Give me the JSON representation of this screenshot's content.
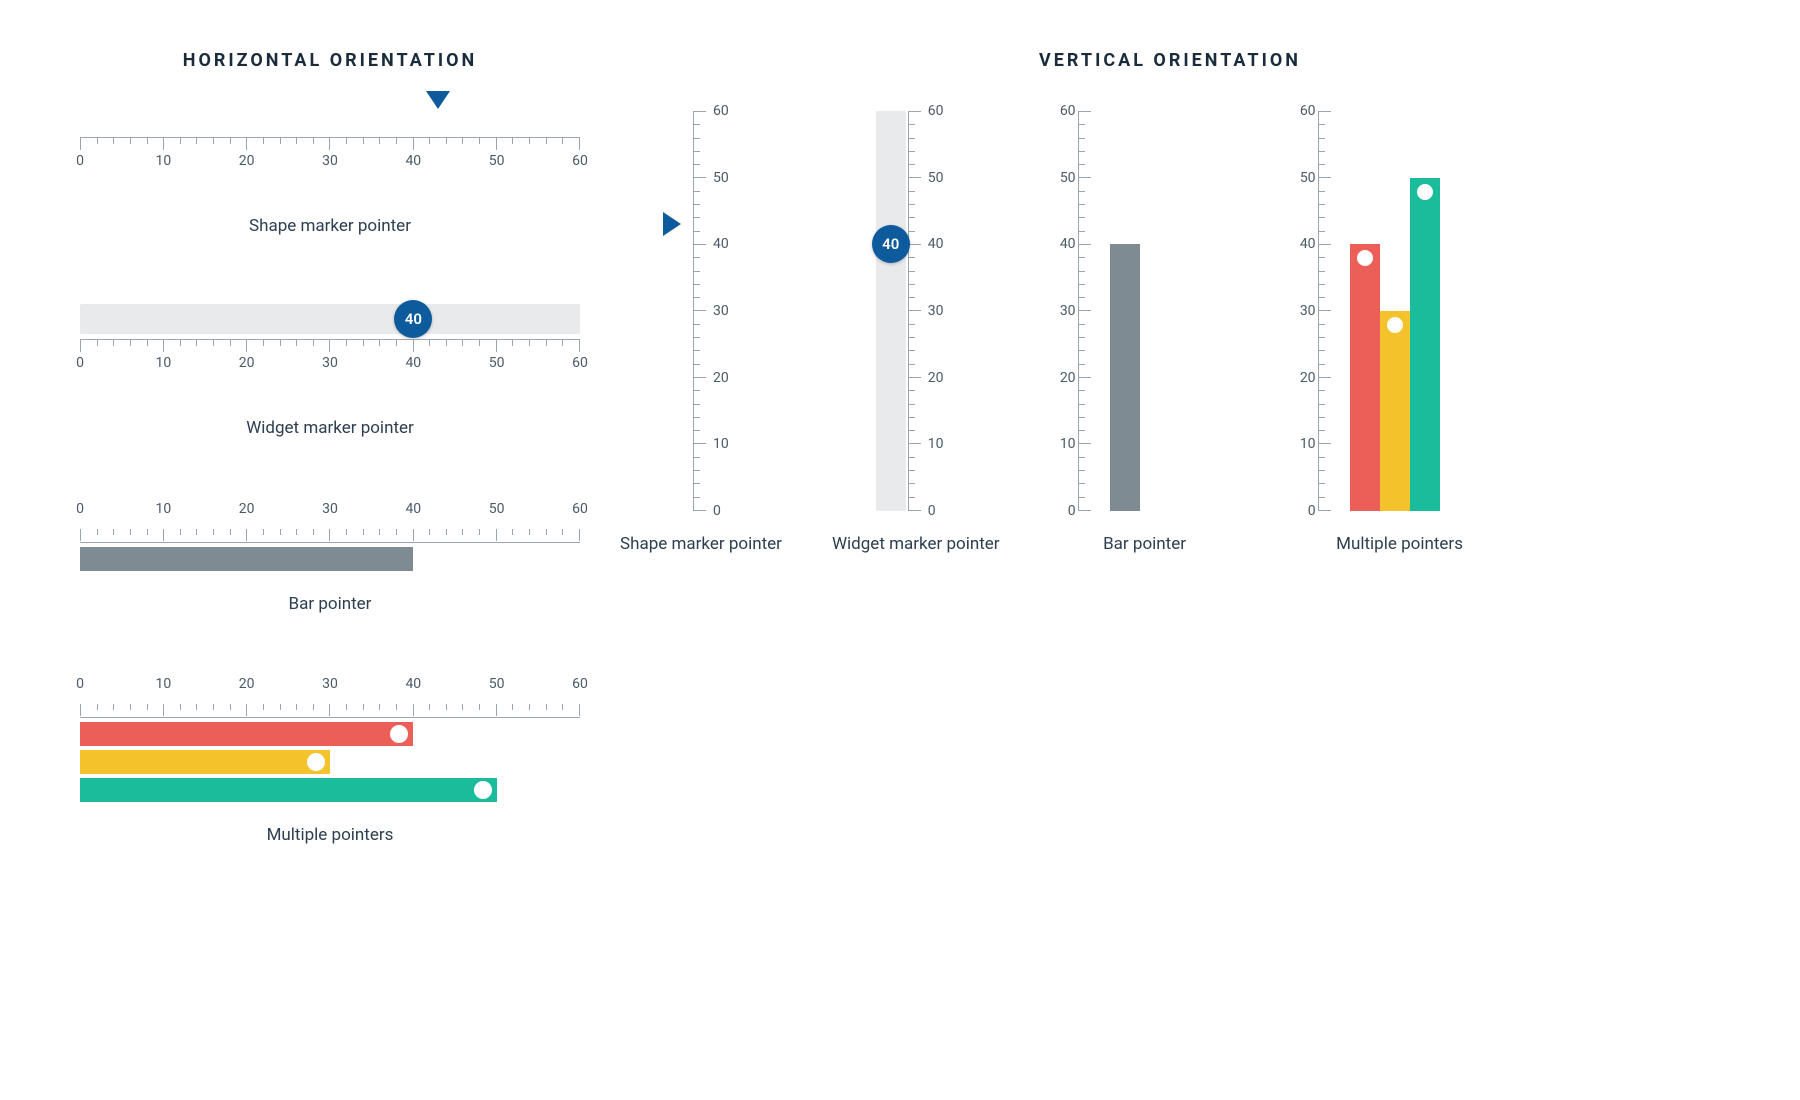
{
  "sections": {
    "horizontalTitle": "HORIZONTAL ORIENTATION",
    "verticalTitle": "VERTICAL ORIENTATION"
  },
  "gaugeCommon": {
    "min": 0,
    "max": 60,
    "majorTicks": [
      0,
      10,
      20,
      30,
      40,
      50,
      60
    ],
    "minorStep": 2
  },
  "horizontal": {
    "shapeMarker": {
      "caption": "Shape marker pointer",
      "value": 43
    },
    "widgetMarker": {
      "caption": "Widget marker pointer",
      "value": 40,
      "display": "40"
    },
    "barPointer": {
      "caption": "Bar pointer",
      "value": 40,
      "color": "#7f8b93"
    },
    "multiple": {
      "caption": "Multiple pointers",
      "bars": [
        {
          "value": 40,
          "color": "#ec5f59"
        },
        {
          "value": 30,
          "color": "#f4c22b"
        },
        {
          "value": 50,
          "color": "#1bbc9b"
        }
      ]
    }
  },
  "vertical": {
    "shapeMarker": {
      "caption": "Shape marker pointer",
      "value": 43
    },
    "widgetMarker": {
      "caption": "Widget marker pointer",
      "value": 40,
      "display": "40"
    },
    "barPointer": {
      "caption": "Bar pointer",
      "value": 40,
      "color": "#7f8b93"
    },
    "multiple": {
      "caption": "Multiple pointers",
      "bars": [
        {
          "value": 40,
          "color": "#ec5f59"
        },
        {
          "value": 30,
          "color": "#f4c22b"
        },
        {
          "value": 50,
          "color": "#1bbc9b"
        }
      ]
    }
  },
  "chart_data": [
    {
      "type": "bar",
      "orientation": "horizontal",
      "name": "Shape marker pointer",
      "min": 0,
      "max": 60,
      "values": [
        43
      ],
      "ticks": [
        0,
        10,
        20,
        30,
        40,
        50,
        60
      ]
    },
    {
      "type": "bar",
      "orientation": "horizontal",
      "name": "Widget marker pointer",
      "min": 0,
      "max": 60,
      "values": [
        40
      ],
      "ticks": [
        0,
        10,
        20,
        30,
        40,
        50,
        60
      ]
    },
    {
      "type": "bar",
      "orientation": "horizontal",
      "name": "Bar pointer",
      "min": 0,
      "max": 60,
      "values": [
        40
      ],
      "ticks": [
        0,
        10,
        20,
        30,
        40,
        50,
        60
      ]
    },
    {
      "type": "bar",
      "orientation": "horizontal",
      "name": "Multiple pointers",
      "min": 0,
      "max": 60,
      "series": [
        {
          "name": "red",
          "values": [
            40
          ],
          "color": "#ec5f59"
        },
        {
          "name": "yellow",
          "values": [
            30
          ],
          "color": "#f4c22b"
        },
        {
          "name": "teal",
          "values": [
            50
          ],
          "color": "#1bbc9b"
        }
      ],
      "ticks": [
        0,
        10,
        20,
        30,
        40,
        50,
        60
      ]
    },
    {
      "type": "bar",
      "orientation": "vertical",
      "name": "Shape marker pointer",
      "min": 0,
      "max": 60,
      "values": [
        43
      ],
      "ticks": [
        0,
        10,
        20,
        30,
        40,
        50,
        60
      ]
    },
    {
      "type": "bar",
      "orientation": "vertical",
      "name": "Widget marker pointer",
      "min": 0,
      "max": 60,
      "values": [
        40
      ],
      "ticks": [
        0,
        10,
        20,
        30,
        40,
        50,
        60
      ]
    },
    {
      "type": "bar",
      "orientation": "vertical",
      "name": "Bar pointer",
      "min": 0,
      "max": 60,
      "values": [
        40
      ],
      "ticks": [
        0,
        10,
        20,
        30,
        40,
        50,
        60
      ]
    },
    {
      "type": "bar",
      "orientation": "vertical",
      "name": "Multiple pointers",
      "min": 0,
      "max": 60,
      "series": [
        {
          "name": "red",
          "values": [
            40
          ],
          "color": "#ec5f59"
        },
        {
          "name": "yellow",
          "values": [
            30
          ],
          "color": "#f4c22b"
        },
        {
          "name": "teal",
          "values": [
            50
          ],
          "color": "#1bbc9b"
        }
      ],
      "ticks": [
        0,
        10,
        20,
        30,
        40,
        50,
        60
      ]
    }
  ]
}
